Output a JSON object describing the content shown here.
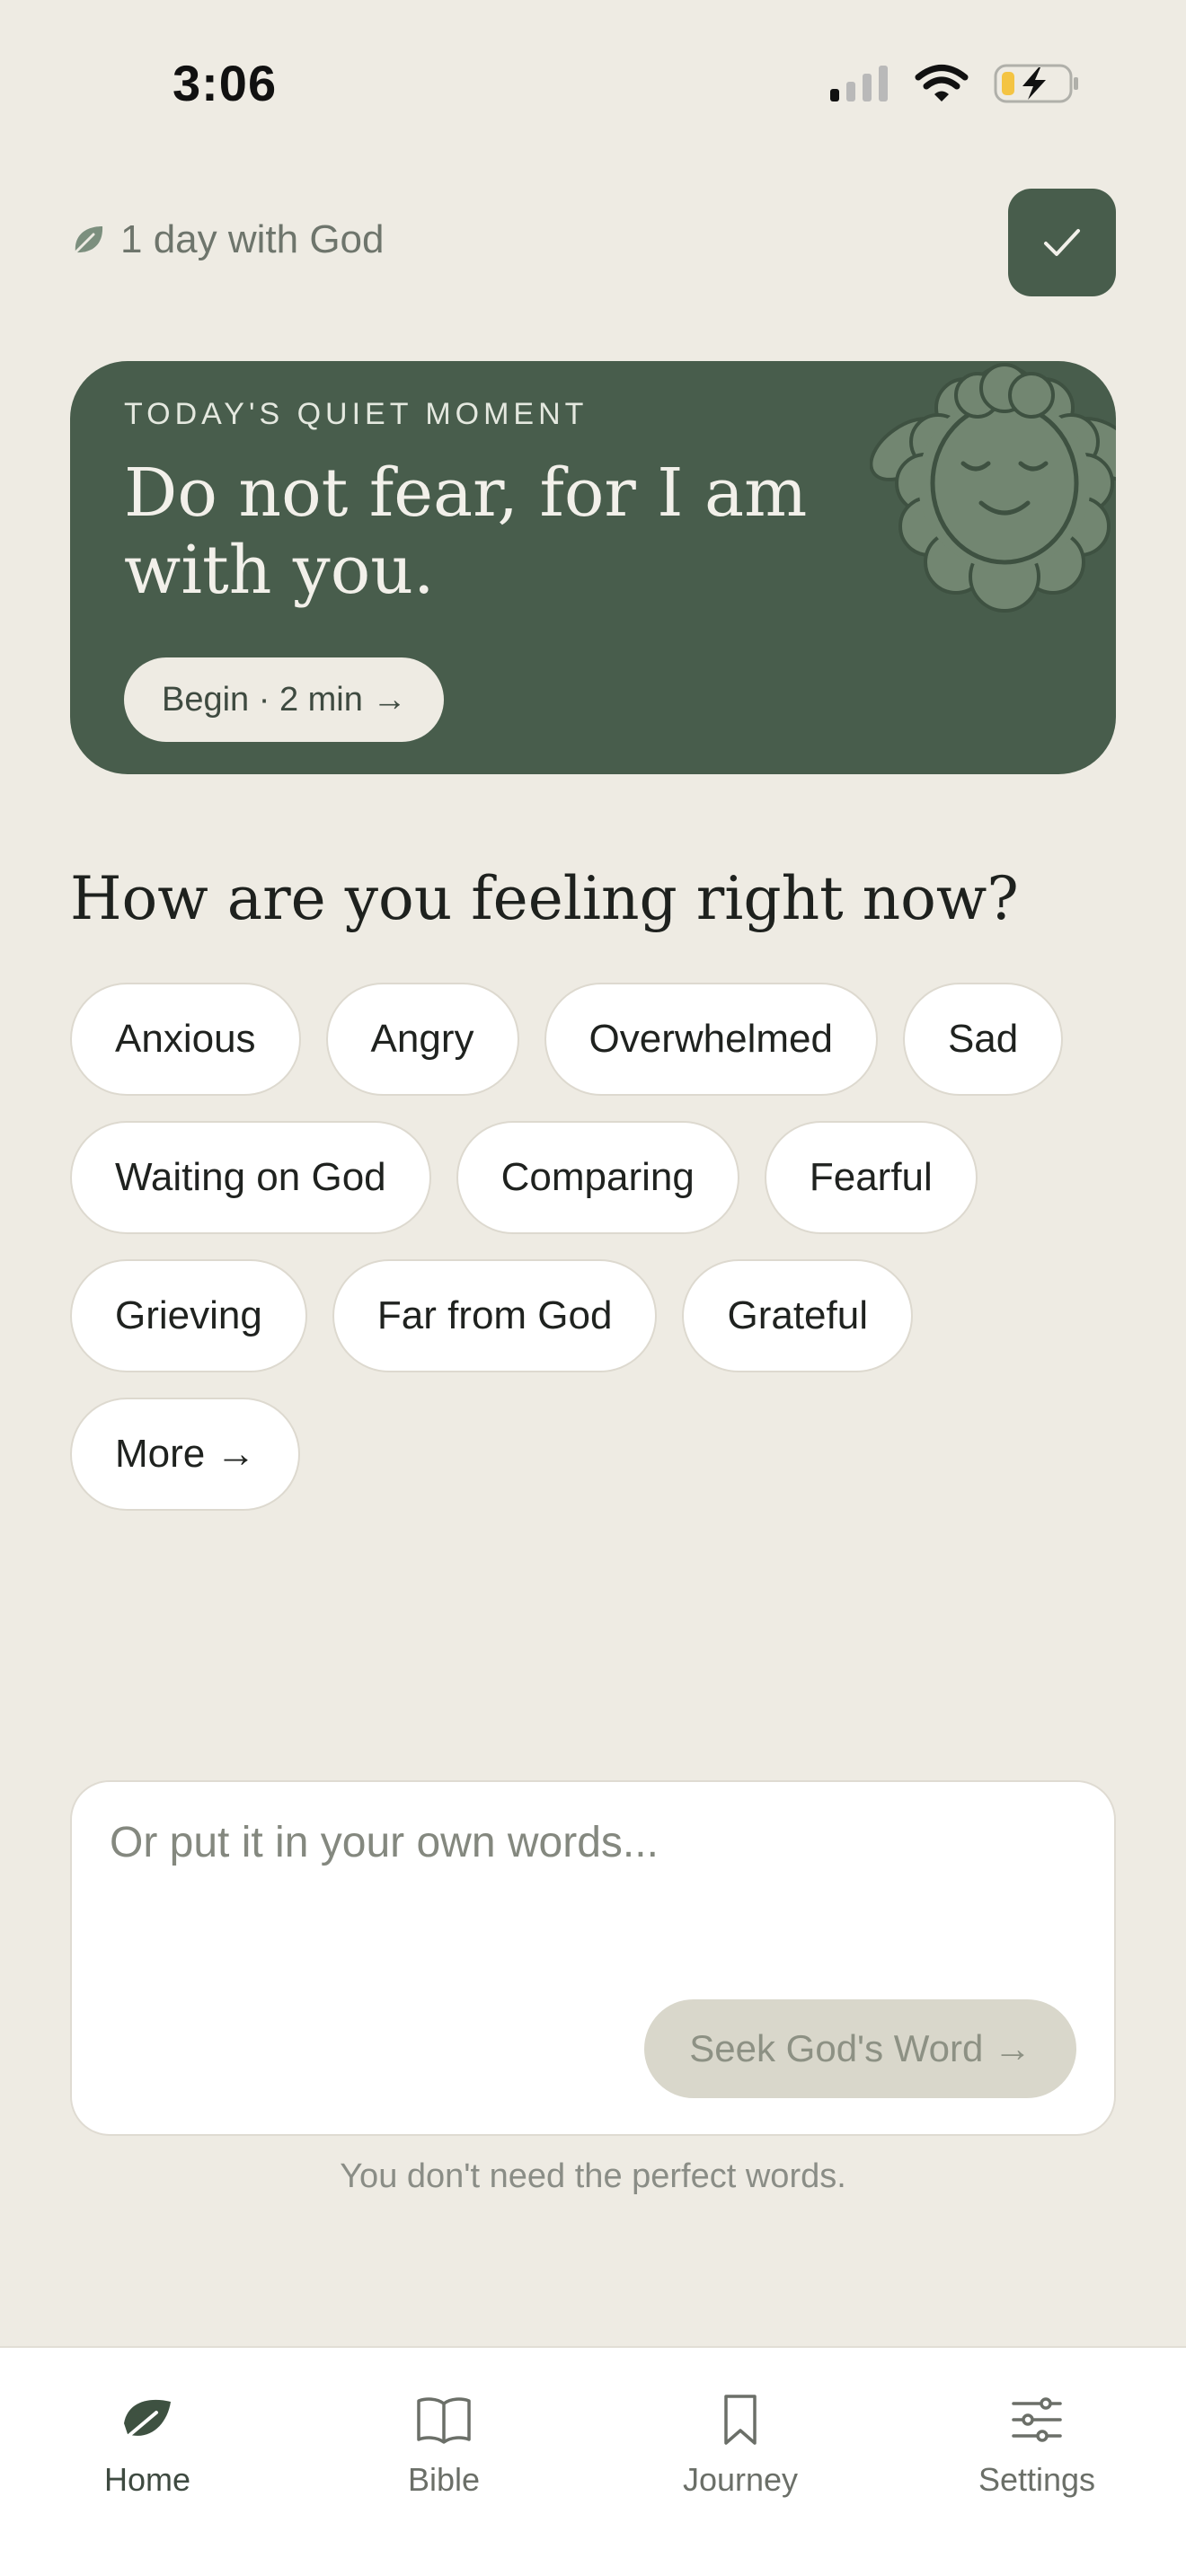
{
  "status_bar": {
    "time": "3:06",
    "icons": [
      "cellular-signal-icon",
      "wifi-icon",
      "battery-charging-icon"
    ]
  },
  "header": {
    "streak_text": "1 day with God",
    "streak_icon": "leaf-icon",
    "check_icon": "checkmark-icon"
  },
  "quiet_moment": {
    "eyebrow": "TODAY'S QUIET MOMENT",
    "title": "Do not fear, for I am with you.",
    "button_label": "Begin · 2 min →",
    "illustration": "sheep-icon"
  },
  "feelings": {
    "heading": "How are you feeling right now?",
    "rows": [
      [
        "Anxious",
        "Angry",
        "Overwhelmed",
        "Sad"
      ],
      [
        "Waiting on God",
        "Comparing",
        "Fearful"
      ],
      [
        "Grieving",
        "Far from God",
        "Grateful"
      ],
      [
        "More →"
      ]
    ]
  },
  "input": {
    "placeholder": "Or put it in your own words...",
    "submit_label": "Seek God's Word →",
    "helper_text": "You don't need the perfect words."
  },
  "tabbar": {
    "items": [
      {
        "label": "Home",
        "icon": "leaf-icon",
        "active": true
      },
      {
        "label": "Bible",
        "icon": "book-icon",
        "active": false
      },
      {
        "label": "Journey",
        "icon": "bookmark-icon",
        "active": false
      },
      {
        "label": "Settings",
        "icon": "sliders-icon",
        "active": false
      }
    ]
  },
  "colors": {
    "background": "#EEEBE3",
    "primary_green": "#485D4C",
    "chip_background": "#FFFFFF",
    "disabled_button": "#D9D7CB"
  }
}
